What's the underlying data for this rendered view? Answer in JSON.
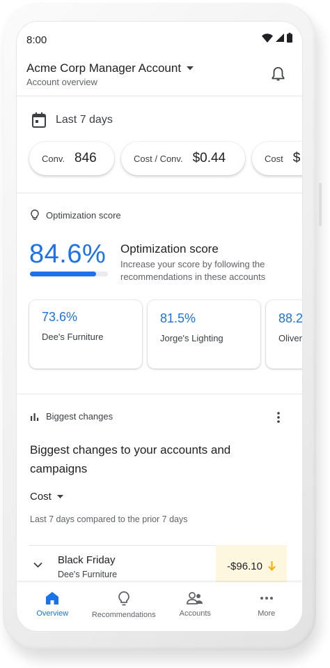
{
  "status_bar": {
    "time": "8:00"
  },
  "header": {
    "account_name": "Acme Corp Manager Account",
    "subtitle": "Account overview"
  },
  "date_range": {
    "label": "Last 7 days"
  },
  "metrics": [
    {
      "label": "Conv.",
      "value": "846"
    },
    {
      "label": "Cost / Conv.",
      "value": "$0.44"
    },
    {
      "label": "Cost",
      "value": "$"
    }
  ],
  "optimization": {
    "section_label": "Optimization score",
    "score": "84.6%",
    "score_fraction": 0.846,
    "heading": "Optimization score",
    "description": "Increase your score by following the recommendations in these accounts",
    "accounts": [
      {
        "score": "73.6%",
        "name": "Dee's Furniture"
      },
      {
        "score": "81.5%",
        "name": "Jorge's Lighting"
      },
      {
        "score": "88.2",
        "name": "Oliver"
      }
    ]
  },
  "biggest_changes": {
    "section_label": "Biggest changes",
    "title": "Biggest changes to your accounts and campaigns",
    "metric_selector": "Cost",
    "comparison": "Last 7 days compared to the prior 7 days",
    "rows": [
      {
        "title": "Black Friday",
        "subtitle": "Dee's Furniture",
        "delta": "-$96.10"
      }
    ]
  },
  "bottom_nav": [
    {
      "label": "Overview",
      "icon": "home-icon",
      "active": true
    },
    {
      "label": "Recommendations",
      "icon": "lightbulb-icon",
      "active": false
    },
    {
      "label": "Accounts",
      "icon": "accounts-icon",
      "active": false
    },
    {
      "label": "More",
      "icon": "more-horizontal-icon",
      "active": false
    }
  ],
  "colors": {
    "accent": "#1a73e8",
    "delta_highlight": "#fef7e0",
    "down_arrow": "#f9ab00"
  }
}
